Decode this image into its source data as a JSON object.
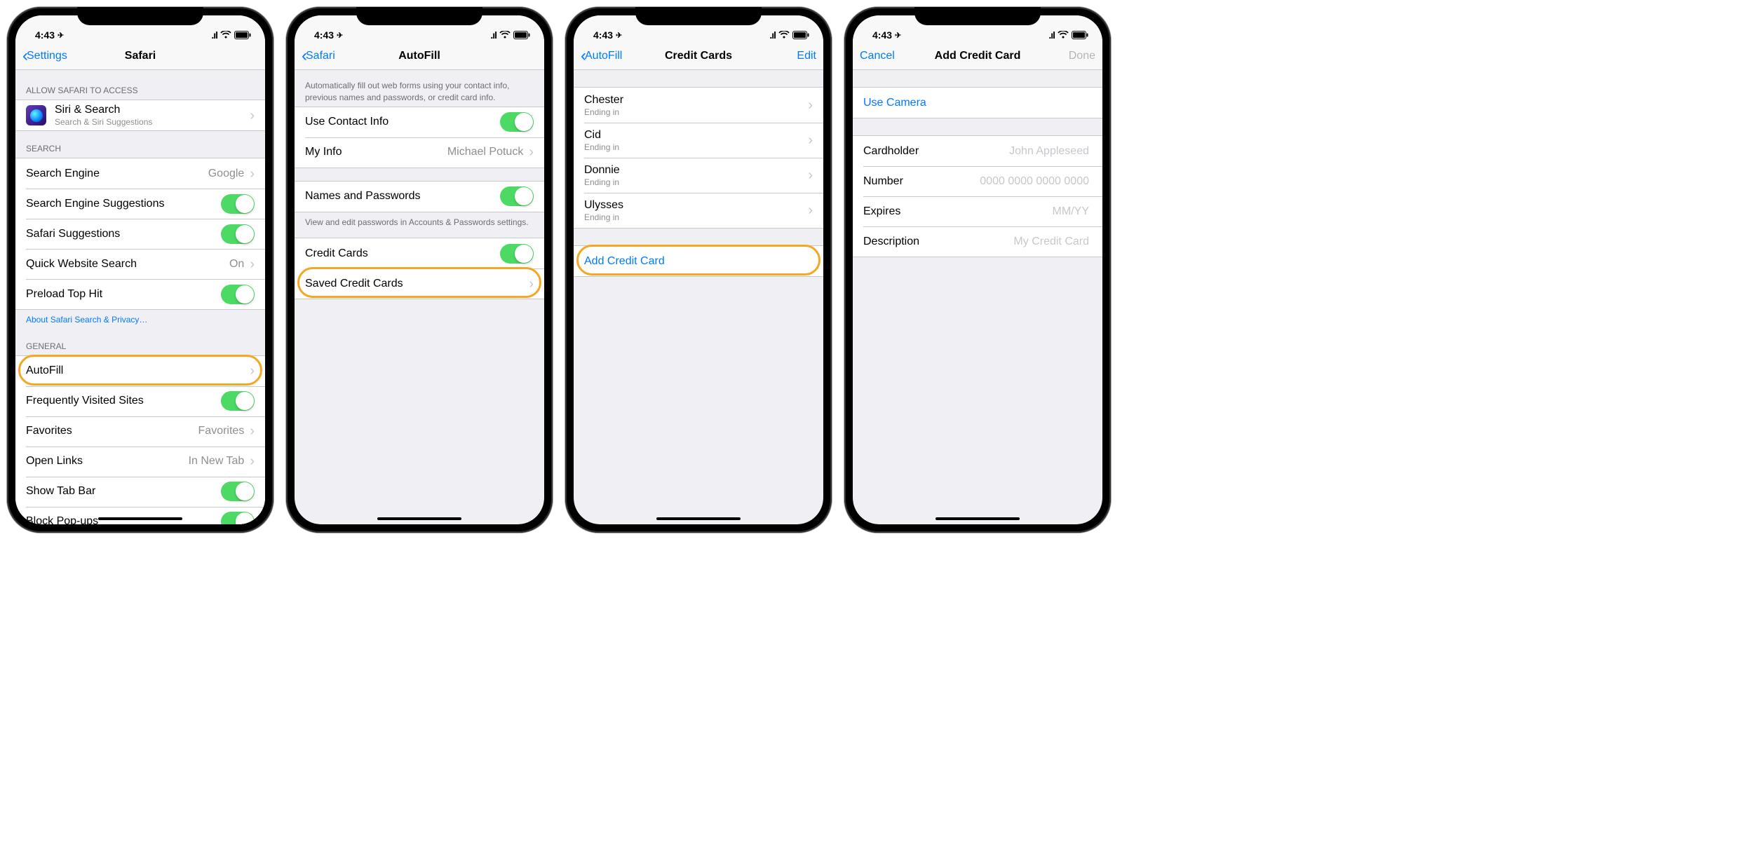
{
  "status": {
    "time": "4:43",
    "location_icon": "➤",
    "signal": "••ıl",
    "wifi": "wifi",
    "battery": "bat"
  },
  "screen1": {
    "back": "Settings",
    "title": "Safari",
    "sec_allow": "ALLOW SAFARI TO ACCESS",
    "siri": {
      "title": "Siri & Search",
      "sub": "Search & Siri Suggestions"
    },
    "sec_search": "SEARCH",
    "search_engine": {
      "label": "Search Engine",
      "value": "Google"
    },
    "ses": "Search Engine Suggestions",
    "safari_sugg": "Safari Suggestions",
    "quick": {
      "label": "Quick Website Search",
      "value": "On"
    },
    "preload": "Preload Top Hit",
    "about": "About Safari Search & Privacy…",
    "sec_general": "GENERAL",
    "autofill": "AutoFill",
    "freq": "Frequently Visited Sites",
    "favorites": {
      "label": "Favorites",
      "value": "Favorites"
    },
    "open_links": {
      "label": "Open Links",
      "value": "In New Tab"
    },
    "tab_bar": "Show Tab Bar",
    "popups": "Block Pop-ups"
  },
  "screen2": {
    "back": "Safari",
    "title": "AutoFill",
    "footer1": "Automatically fill out web forms using your contact info, previous names and passwords, or credit card info.",
    "use_contact": "Use Contact Info",
    "my_info": {
      "label": "My Info",
      "value": "Michael Potuck"
    },
    "names_pw": "Names and Passwords",
    "footer2": "View and edit passwords in Accounts & Passwords settings.",
    "credit_cards": "Credit Cards",
    "saved_cc": "Saved Credit Cards"
  },
  "screen3": {
    "back": "AutoFill",
    "title": "Credit Cards",
    "edit": "Edit",
    "cards": [
      {
        "name": "Chester",
        "sub": "Ending in"
      },
      {
        "name": "Cid",
        "sub": "Ending in"
      },
      {
        "name": "Donnie",
        "sub": "Ending in"
      },
      {
        "name": "Ulysses",
        "sub": "Ending in"
      }
    ],
    "add": "Add Credit Card"
  },
  "screen4": {
    "cancel": "Cancel",
    "title": "Add Credit Card",
    "done": "Done",
    "use_camera": "Use Camera",
    "fields": {
      "cardholder": {
        "label": "Cardholder",
        "placeholder": "John Appleseed"
      },
      "number": {
        "label": "Number",
        "placeholder": "0000 0000 0000 0000"
      },
      "expires": {
        "label": "Expires",
        "placeholder": "MM/YY"
      },
      "description": {
        "label": "Description",
        "placeholder": "My Credit Card"
      }
    }
  }
}
